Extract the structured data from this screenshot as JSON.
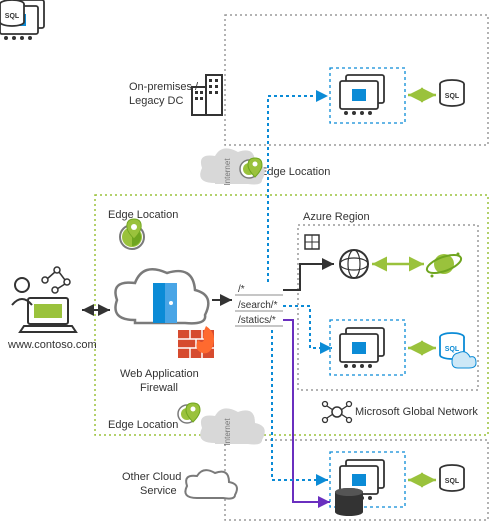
{
  "labels": {
    "onprem": "On-premises /",
    "onprem2": "Legacy DC",
    "edgeTop": "Edge Location",
    "edgeLeft": "Edge Location",
    "edgeBottom": "Edge Location",
    "azureRegion": "Azure Region",
    "waf": "Web Application",
    "waf2": "Firewall",
    "www": "www.contoso.com",
    "mgn": "Microsoft Global Network",
    "otherCloud": "Other Cloud",
    "otherCloud2": "Service",
    "routeRoot": "/*",
    "routeSearch": "/search/*",
    "routeStatics": "/statics/*",
    "internet": "Internet"
  },
  "colors": {
    "grey": "#7a7a7a",
    "greyDot": "#9a9a9a",
    "blue": "#0b8bd6",
    "blueLight": "#49a5e6",
    "green": "#9ac23c",
    "greenDark": "#6fa51f",
    "purple": "#6a2fbf",
    "red": "#d64b2f",
    "black": "#333333",
    "cloudGrey": "#bdbdbd"
  }
}
